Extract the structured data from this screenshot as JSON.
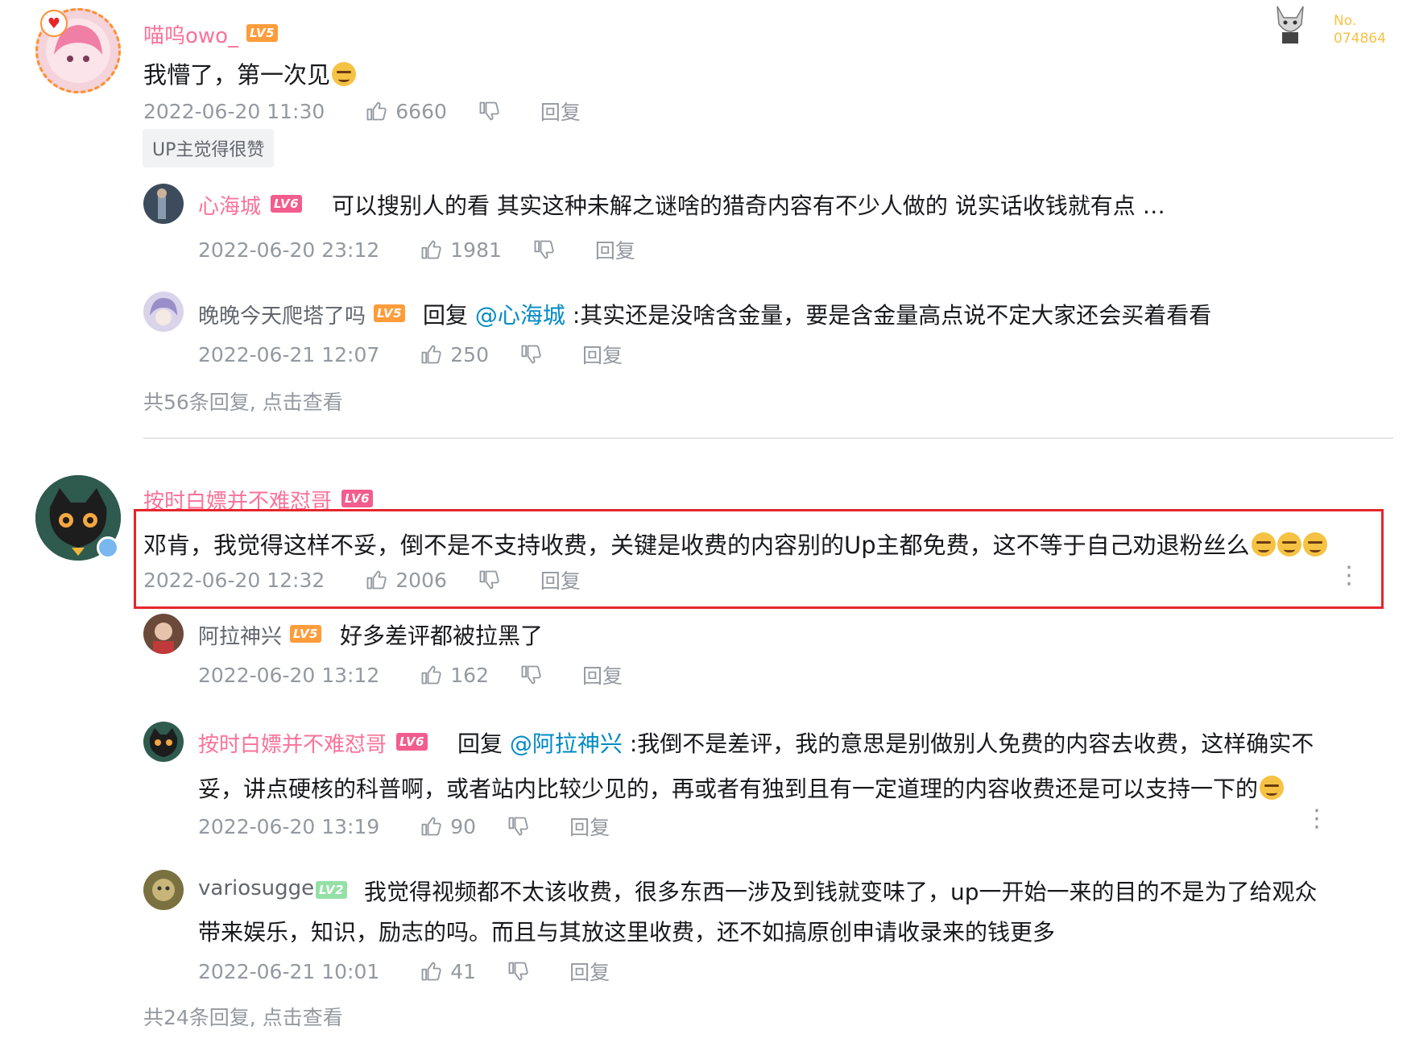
{
  "no_badge": {
    "label": "No.",
    "number": "074864"
  },
  "comments": [
    {
      "user": "喵呜owo_",
      "level": "LV5",
      "text": "我懵了，第一次见",
      "time": "2022-06-20 11:30",
      "likes": "6660",
      "reply_label": "回复",
      "badge": "UP主觉得很赞",
      "replies": [
        {
          "user": "心海城",
          "level": "LV6",
          "text": "可以搜别人的看 其实这种未解之谜啥的猎奇内容有不少人做的 说实话收钱就有点 …",
          "time": "2022-06-20 23:12",
          "likes": "1981",
          "reply_label": "回复"
        },
        {
          "user": "晚晚今天爬塔了吗",
          "level": "LV5",
          "reply_prefix": "回复",
          "mention": "@心海城",
          "text": ":其实还是没啥含金量，要是含金量高点说不定大家还会买着看看",
          "time": "2022-06-21 12:07",
          "likes": "250",
          "reply_label": "回复"
        }
      ],
      "more": "共56条回复, 点击查看"
    },
    {
      "user": "按时白嫖并不难怼哥",
      "level": "LV6",
      "text": "邓肯，我觉得这样不妥，倒不是不支持收费，关键是收费的内容别的Up主都免费，这不等于自己劝退粉丝么",
      "time": "2022-06-20 12:32",
      "likes": "2006",
      "reply_label": "回复",
      "replies": [
        {
          "user": "阿拉神兴",
          "level": "LV5",
          "text": "好多差评都被拉黑了",
          "time": "2022-06-20 13:12",
          "likes": "162",
          "reply_label": "回复"
        },
        {
          "user": "按时白嫖并不难怼哥",
          "level": "LV6",
          "reply_prefix": "回复",
          "mention": "@阿拉神兴",
          "text": ":我倒不是差评，我的意思是别做别人免费的内容去收费，这样确实不",
          "text2": "妥，讲点硬核的科普啊，或者站内比较少见的，再或者有独到且有一定道理的内容收费还是可以支持一下的",
          "time": "2022-06-20 13:19",
          "likes": "90",
          "reply_label": "回复"
        },
        {
          "user": "variosugge",
          "level": "LV2",
          "text": "我觉得视频都不太该收费，很多东西一涉及到钱就变味了，up一开始一来的目的不是为了给观众",
          "text2": "带来娱乐，知识，励志的吗。而且与其放这里收费，还不如搞原创申请收录来的钱更多",
          "time": "2022-06-21 10:01",
          "likes": "41",
          "reply_label": "回复"
        }
      ],
      "more": "共24条回复, 点击查看"
    }
  ],
  "colors": {
    "accent_pink": "#fb7299",
    "mention_blue": "#008ac5",
    "highlight_red": "#e5262b",
    "meta_gray": "#9499a0"
  }
}
